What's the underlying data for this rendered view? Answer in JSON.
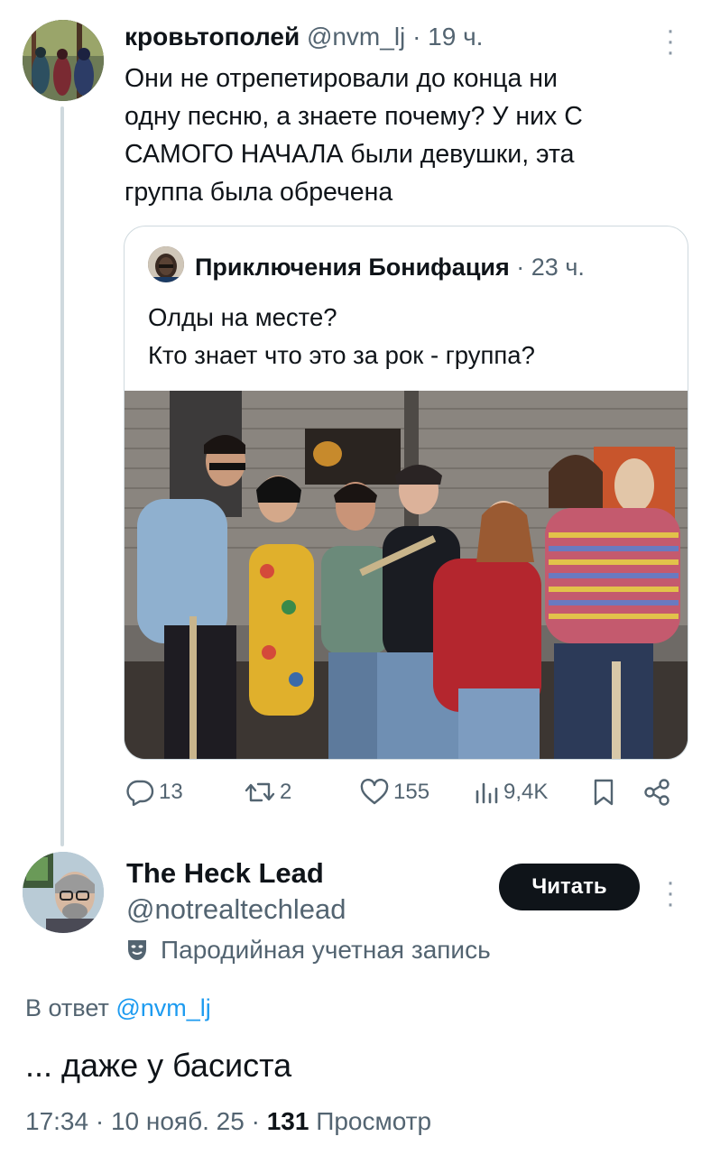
{
  "tweet": {
    "author_name": "кровьтополей",
    "handle": "@nvm_lj",
    "time": "· 19 ч.",
    "text_lines": [
      "Они не отрепетировали до конца ни",
      "одну песню, а знаете почему? У них С",
      "САМОГО НАЧАЛА были девушки, эта",
      "группа была обречена"
    ],
    "quote": {
      "author_name": "Приключения Бонифация",
      "time": "· 23 ч.",
      "text_lines": [
        "Олды на месте?",
        "Кто знает что это за рок - группа?"
      ]
    },
    "actions": {
      "replies": "13",
      "retweets": "2",
      "likes": "155",
      "views": "9,4K"
    }
  },
  "reply": {
    "author_name": "The Heck Lead",
    "handle": "@notrealtechlead",
    "follow_label": "Читать",
    "parody_label": "Пародийная учетная запись",
    "reply_to_label": "В ответ",
    "reply_to_handle": "@nvm_lj",
    "text": "... даже у басиста",
    "timestamp": "17:34 · 10 нояб. 25 · ",
    "views_count": "131",
    "views_label": " Просмотр"
  },
  "colors": {
    "text": "#0f1419",
    "muted": "#536471",
    "link": "#1d9bf0",
    "border": "#cfd9de",
    "button": "#0f1419"
  }
}
